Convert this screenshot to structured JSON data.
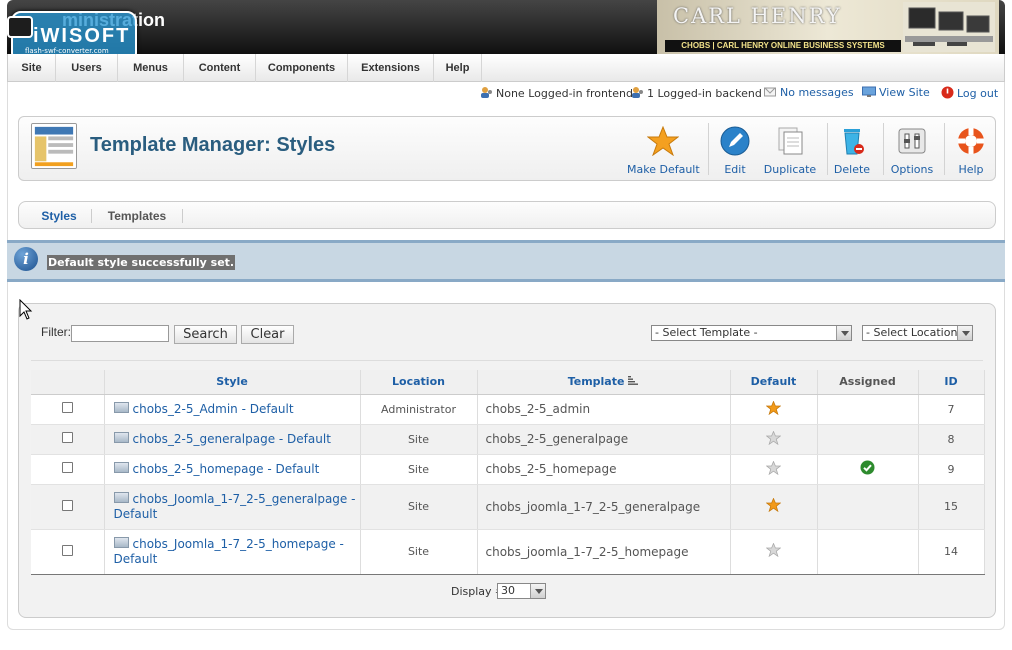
{
  "header": {
    "title_partial": "ministration",
    "brand_text": "CARL HENRY",
    "brand_strap": "CHOBS | CARL HENRY ONLINE BUSINESS SYSTEMS"
  },
  "watermark": {
    "name": "iWISOFT",
    "sub": "flash-swf-converter.com"
  },
  "menu": [
    "Site",
    "Users",
    "Menus",
    "Content",
    "Components",
    "Extensions",
    "Help"
  ],
  "status": {
    "frontend": "None Logged-in frontend",
    "backend": "1 Logged-in backend",
    "messages": "No messages",
    "view_site": "View Site",
    "logout": "Log out"
  },
  "toolbar": {
    "title": "Template Manager: Styles",
    "buttons": {
      "make_default": "Make Default",
      "edit": "Edit",
      "duplicate": "Duplicate",
      "delete": "Delete",
      "options": "Options",
      "help": "Help"
    }
  },
  "submenu": {
    "styles": "Styles",
    "templates": "Templates"
  },
  "message": "Default style successfully set.",
  "filter": {
    "label": "Filter:",
    "value": "",
    "search_label": "Search",
    "clear_label": "Clear",
    "template_select": "- Select Template -",
    "location_select": "- Select Location -"
  },
  "table": {
    "headers": [
      "Style",
      "Location",
      "Template",
      "Default",
      "Assigned",
      "ID"
    ],
    "rows": [
      {
        "style": "chobs_2-5_Admin - Default",
        "location": "Administrator",
        "template": "chobs_2-5_admin",
        "default": true,
        "assigned": false,
        "id": "7"
      },
      {
        "style": "chobs_2-5_generalpage - Default",
        "location": "Site",
        "template": "chobs_2-5_generalpage",
        "default": false,
        "assigned": false,
        "id": "8"
      },
      {
        "style": "chobs_2-5_homepage - Default",
        "location": "Site",
        "template": "chobs_2-5_homepage",
        "default": false,
        "assigned": true,
        "id": "9"
      },
      {
        "style": "chobs_Joomla_1-7_2-5_generalpage - Default",
        "location": "Site",
        "template": "chobs_joomla_1-7_2-5_generalpage",
        "default": true,
        "assigned": false,
        "id": "15"
      },
      {
        "style": "chobs_Joomla_1-7_2-5_homepage - Default",
        "location": "Site",
        "template": "chobs_joomla_1-7_2-5_homepage",
        "default": false,
        "assigned": false,
        "id": "14"
      }
    ]
  },
  "pagination": {
    "label": "Display #",
    "value": "30"
  },
  "colors": {
    "link": "#1e5fa6",
    "title": "#2a5d7f",
    "message_bg": "#c8d7e3",
    "star_on": "#f29a1a",
    "star_off": "#d8d8d8",
    "assigned": "#2e8b2e"
  }
}
